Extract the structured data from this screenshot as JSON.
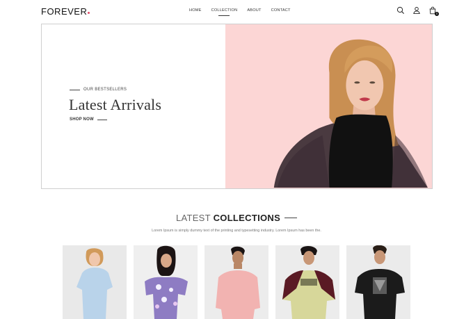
{
  "brand": {
    "name": "FOREVER",
    "dot_color": "#e24c6a"
  },
  "nav": {
    "items": [
      {
        "label": "HOME",
        "active": false
      },
      {
        "label": "COLLECTION",
        "active": true
      },
      {
        "label": "ABOUT",
        "active": false
      },
      {
        "label": "CONTACT",
        "active": false
      }
    ],
    "icons": [
      "search-icon",
      "profile-icon",
      "cart-icon"
    ],
    "cart_count": "0"
  },
  "hero": {
    "eyebrow": "OUR BESTSELLERS",
    "title": "Latest Arrivals",
    "cta": "SHOP NOW",
    "bg_color": "#fcd6d5"
  },
  "collections": {
    "title_light": "LATEST",
    "title_bold": "COLLECTIONS",
    "subtitle": "Lorem Ipsum is simply dummy text of the printing and typesetting industry. Lorem Ipsum has been the.",
    "products": [
      {
        "name": "product-1",
        "shirt_color": "#b9d3ea"
      },
      {
        "name": "product-2",
        "shirt_color": "#8e7cc3"
      },
      {
        "name": "product-3",
        "shirt_color": "#f2b3b1"
      },
      {
        "name": "product-4",
        "shirt_color": "#d7d79a"
      },
      {
        "name": "product-5",
        "shirt_color": "#1b1b1b"
      }
    ]
  }
}
